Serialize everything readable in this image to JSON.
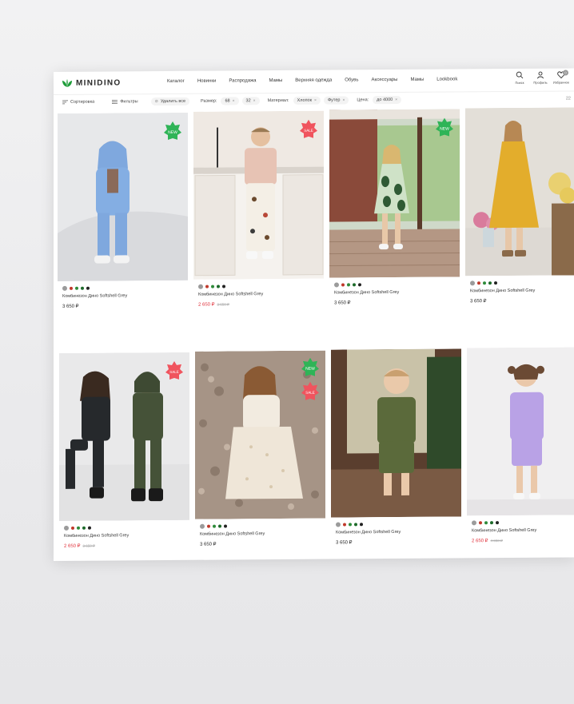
{
  "brand": {
    "logo_text": "MINIDINO",
    "logo_color": "#1f9d3a"
  },
  "nav": [
    "Каталог",
    "Новинки",
    "Распродажа",
    "Мамы",
    "Верхняя одежда",
    "Обувь",
    "Аксессуары",
    "Мамы",
    "Lookbook"
  ],
  "header_icons": [
    {
      "icon": "search-icon",
      "label": "Поиск"
    },
    {
      "icon": "profile-icon",
      "label": "Профиль"
    },
    {
      "icon": "heart-icon",
      "label": "Избранное",
      "badge": "0"
    }
  ],
  "filters": {
    "sort_label": "Сортировка",
    "filter_label": "Фильтры",
    "clear_label": "Удалить все",
    "size_label": "Размер:",
    "size_chips": [
      "68",
      "32"
    ],
    "material_label": "Материал:",
    "material_chips": [
      "Хлопок",
      "Футер"
    ],
    "price_label": "Цена:",
    "price_chip": "до 4000",
    "result_count": "22"
  },
  "colors": {
    "sale": "#e0313b",
    "new_sticker": "#2fb457",
    "sale_sticker": "#f0545e"
  },
  "swatch_colors": [
    "#9b9b9b",
    "#c0392b",
    "#2e8b3a",
    "#1d6a2a",
    "#222222"
  ],
  "products": [
    {
      "name": "Комбинезон Дино Softshell Grey",
      "price": "3 650 ₽",
      "old_price": "",
      "sale": false,
      "sticker": "NEW",
      "photo": "blue-tracksuit-boy"
    },
    {
      "name": "Комбинезон Дино Softshell Grey",
      "price": "2 650 ₽",
      "old_price": "3 650 ₽",
      "sale": true,
      "sticker": "SALE",
      "photo": "beige-tee-boy-kitchen"
    },
    {
      "name": "Комбинезон Дино Softshell Grey",
      "price": "3 650 ₽",
      "old_price": "",
      "sale": false,
      "sticker": "NEW",
      "photo": "avocado-dress-girl"
    },
    {
      "name": "Комбинезон Дино Softshell Grey",
      "price": "3 650 ₽",
      "old_price": "",
      "sale": false,
      "sticker": "",
      "photo": "mustard-dress-girl"
    },
    {
      "name": "Комбинезон Дино Softshell Grey",
      "price": "2 650 ₽",
      "old_price": "3 650 ₽",
      "sale": true,
      "sticker": "SALE",
      "photo": "dark-suits-kids"
    },
    {
      "name": "Комбинезон Дино Softshell Grey",
      "price": "3 650 ₽",
      "old_price": "",
      "sale": false,
      "sticker": "NEW+SALE",
      "photo": "white-dress-girl-pebbles"
    },
    {
      "name": "Комбинезон Дино Softshell Grey",
      "price": "3 650 ₽",
      "old_price": "",
      "sale": false,
      "sticker": "",
      "photo": "olive-set-boy"
    },
    {
      "name": "Комбинезон Дино Softshell Grey",
      "price": "2 650 ₽",
      "old_price": "4 650 ₽",
      "sale": true,
      "sticker": "",
      "photo": "lilac-set-girl"
    }
  ]
}
